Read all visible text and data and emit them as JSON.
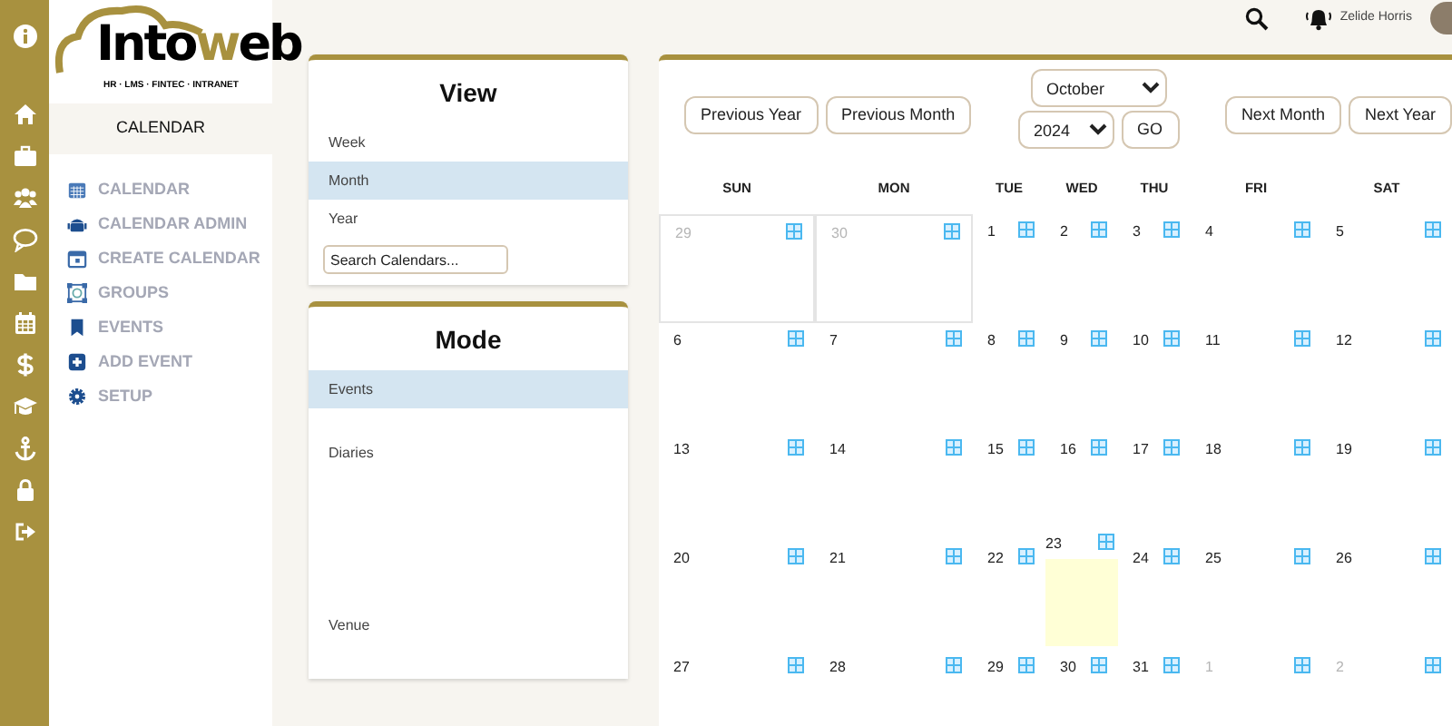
{
  "rail": [
    {
      "kind": "info"
    },
    {
      "kind": "home"
    },
    {
      "kind": "briefcase"
    },
    {
      "kind": "users"
    },
    {
      "kind": "chat"
    },
    {
      "kind": "folder"
    },
    {
      "kind": "calendar"
    },
    {
      "kind": "dollar"
    },
    {
      "kind": "graduation"
    },
    {
      "kind": "anchor"
    },
    {
      "kind": "lock"
    },
    {
      "kind": "logout"
    }
  ],
  "logo": {
    "parts": [
      {
        "text": "Into",
        "accent": false
      },
      {
        "text": "w",
        "accent": true
      },
      {
        "text": "eb",
        "accent": false
      }
    ],
    "tagline": "HR · LMS · FINTEC · INTRANET"
  },
  "sidebar": {
    "title": "CALENDAR",
    "items": [
      {
        "label": "CALENDAR",
        "kind": "calendar"
      },
      {
        "label": "CALENDAR ADMIN",
        "kind": "android"
      },
      {
        "label": "CREATE CALENDAR",
        "kind": "calendar-add"
      },
      {
        "label": "GROUPS",
        "kind": "groups"
      },
      {
        "label": "EVENTS",
        "kind": "bookmark"
      },
      {
        "label": "ADD EVENT",
        "kind": "plus"
      },
      {
        "label": "SETUP",
        "kind": "gear"
      }
    ]
  },
  "topbar": {
    "user": "Zelide Horris"
  },
  "view_panel": {
    "title": "View",
    "items": [
      {
        "label": "Week",
        "selected": false
      },
      {
        "label": "Month",
        "selected": true
      },
      {
        "label": "Year",
        "selected": false
      }
    ],
    "search": {
      "placeholder": "Search Calendars..."
    }
  },
  "mode_panel": {
    "title": "Mode",
    "items": [
      {
        "label": "Events",
        "selected": true
      },
      {
        "label": "Diaries",
        "selected": false
      },
      {
        "label": "Venue",
        "selected": false
      }
    ]
  },
  "calendar": {
    "buttons_left": [
      "Previous Year",
      "Previous Month"
    ],
    "month": "October",
    "year": "2024",
    "go": "GO",
    "buttons_right": [
      "Next Month",
      "Next Year"
    ],
    "weekdays": [
      "SUN",
      "MON",
      "TUE",
      "WED",
      "THU",
      "FRI",
      "SAT"
    ],
    "days": [
      {
        "day": "29",
        "kind": "prev",
        "today": false
      },
      {
        "day": "30",
        "kind": "prev",
        "today": false
      },
      {
        "day": "1",
        "kind": "current",
        "today": false
      },
      {
        "day": "2",
        "kind": "current",
        "today": false
      },
      {
        "day": "3",
        "kind": "current",
        "today": false
      },
      {
        "day": "4",
        "kind": "current",
        "today": false
      },
      {
        "day": "5",
        "kind": "current",
        "today": false
      },
      {
        "day": "6",
        "kind": "current",
        "today": false
      },
      {
        "day": "7",
        "kind": "current",
        "today": false
      },
      {
        "day": "8",
        "kind": "current",
        "today": false
      },
      {
        "day": "9",
        "kind": "current",
        "today": false
      },
      {
        "day": "10",
        "kind": "current",
        "today": false
      },
      {
        "day": "11",
        "kind": "current",
        "today": false
      },
      {
        "day": "12",
        "kind": "current",
        "today": false
      },
      {
        "day": "13",
        "kind": "current",
        "today": false
      },
      {
        "day": "14",
        "kind": "current",
        "today": false
      },
      {
        "day": "15",
        "kind": "current",
        "today": false
      },
      {
        "day": "16",
        "kind": "current",
        "today": false
      },
      {
        "day": "17",
        "kind": "current",
        "today": false
      },
      {
        "day": "18",
        "kind": "current",
        "today": false
      },
      {
        "day": "19",
        "kind": "current",
        "today": false
      },
      {
        "day": "20",
        "kind": "current",
        "today": false
      },
      {
        "day": "21",
        "kind": "current",
        "today": false
      },
      {
        "day": "22",
        "kind": "current",
        "today": false
      },
      {
        "day": "23",
        "kind": "current",
        "today": true
      },
      {
        "day": "24",
        "kind": "current",
        "today": false
      },
      {
        "day": "25",
        "kind": "current",
        "today": false
      },
      {
        "day": "26",
        "kind": "current",
        "today": false
      },
      {
        "day": "27",
        "kind": "current",
        "today": false
      },
      {
        "day": "28",
        "kind": "current",
        "today": false
      },
      {
        "day": "29",
        "kind": "current",
        "today": false
      },
      {
        "day": "30",
        "kind": "current",
        "today": false
      },
      {
        "day": "31",
        "kind": "current",
        "today": false
      },
      {
        "day": "1",
        "kind": "next",
        "today": false
      },
      {
        "day": "2",
        "kind": "next",
        "today": false
      }
    ]
  }
}
